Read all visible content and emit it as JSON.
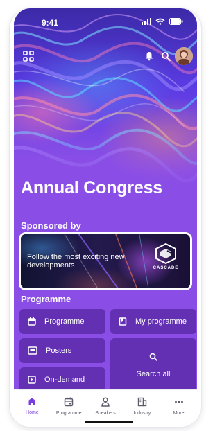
{
  "status_bar": {
    "time": "9:41"
  },
  "hero": {
    "title": "Annual Congress"
  },
  "sections": {
    "sponsored_label": "Sponsored by",
    "programme_label": "Programme"
  },
  "sponsor": {
    "message": "Follow the most exciting new developments",
    "brand": "CASCADE"
  },
  "programme_buttons": [
    {
      "label": "Programme",
      "icon": "calendar-icon"
    },
    {
      "label": "My programme",
      "icon": "bookmark-icon"
    },
    {
      "label": "Posters",
      "icon": "poster-icon"
    },
    {
      "label": "Search all",
      "icon": "search-icon"
    },
    {
      "label": "On-demand",
      "icon": "play-icon"
    }
  ],
  "bottom_nav": [
    {
      "label": "Home",
      "icon": "home-icon",
      "active": true
    },
    {
      "label": "Programme",
      "icon": "calendar-icon",
      "active": false
    },
    {
      "label": "Speakers",
      "icon": "person-icon",
      "active": false
    },
    {
      "label": "Industry",
      "icon": "building-icon",
      "active": false
    },
    {
      "label": "More",
      "icon": "more-icon",
      "active": false
    }
  ],
  "colors": {
    "accent": "#7a3ee0",
    "hero_purple": "#8a4ee6",
    "button_bg": "#5c2caa",
    "white": "#ffffff"
  }
}
